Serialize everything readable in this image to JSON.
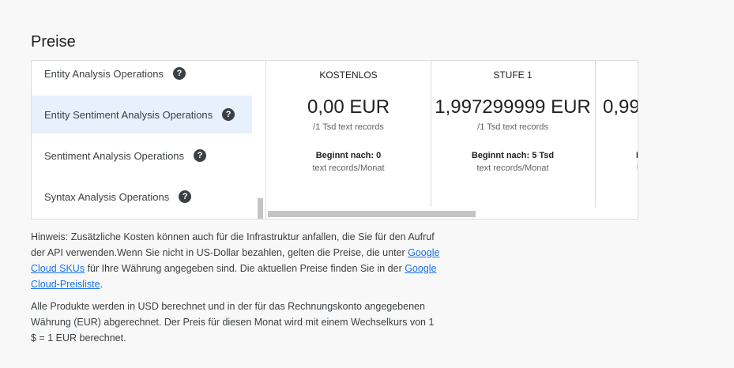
{
  "section": {
    "title": "Preise"
  },
  "operations": [
    {
      "label": "Entity Analysis Operations",
      "selected": false
    },
    {
      "label": "Entity Sentiment Analysis Operations",
      "selected": true
    },
    {
      "label": "Sentiment Analysis Operations",
      "selected": false
    },
    {
      "label": "Syntax Analysis Operations",
      "selected": false
    }
  ],
  "help_icon": {
    "glyph": "?",
    "icon": "help-icon"
  },
  "tiers": [
    {
      "name": "KOSTENLOS",
      "price": "0,00 EUR",
      "unit": "/1 Tsd text records",
      "start": "Beginnt nach: 0",
      "start_unit": "text records/Monat"
    },
    {
      "name": "STUFE 1",
      "price": "1,997299999 EUR",
      "unit": "/1 Tsd text records",
      "start": "Beginnt nach: 5 Tsd",
      "start_unit": "text records/Monat"
    },
    {
      "name": "",
      "price": "0,99",
      "unit": "",
      "start": "B",
      "start_unit": "t"
    }
  ],
  "notes": {
    "p1": {
      "before_link1": "Hinweis: Zusätzliche Kosten können auch für die Infrastruktur anfallen, die Sie für den Aufruf der API verwenden.Wenn Sie nicht in US-Dollar bezahlen, gelten die Preise, die unter ",
      "link1": "Google Cloud SKUs",
      "between": " für Ihre Währung angegeben sind. Die aktuellen Preise finden Sie in der ",
      "link2": "Google Cloud-Preisliste",
      "after": "."
    },
    "p2": "Alle Produkte werden in USD berechnet und in der für das Rechnungskonto angegebenen Währung (EUR) abgerechnet. Der Preis für diesen Monat wird mit einem Wechselkurs von 1 $ = 1 EUR berechnet."
  }
}
